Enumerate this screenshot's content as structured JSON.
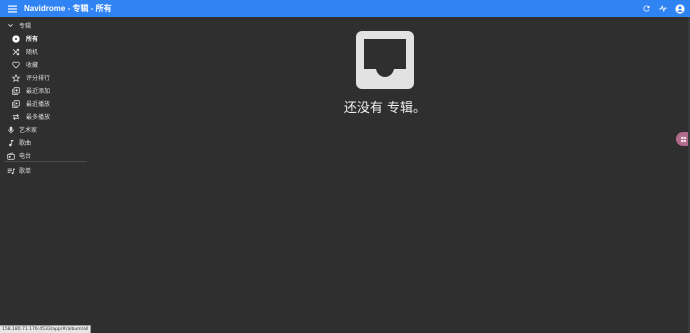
{
  "appbar": {
    "title": "Navidrome - 专辑 - 所有",
    "color": "#2f83f2"
  },
  "sidebar": {
    "items": [
      {
        "label": "专辑",
        "icon": "chevron-down-icon",
        "level": "top"
      },
      {
        "label": "所有",
        "icon": "album-disc-icon",
        "level": "sub",
        "active": true
      },
      {
        "label": "随机",
        "icon": "shuffle-icon",
        "level": "sub"
      },
      {
        "label": "收藏",
        "icon": "heart-icon",
        "level": "sub"
      },
      {
        "label": "评分排行",
        "icon": "star-icon",
        "level": "sub"
      },
      {
        "label": "最近添加",
        "icon": "library-add-icon",
        "level": "sub"
      },
      {
        "label": "最近播放",
        "icon": "library-play-icon",
        "level": "sub"
      },
      {
        "label": "最多播放",
        "icon": "repeat-icon",
        "level": "sub"
      },
      {
        "label": "艺术家",
        "icon": "microphone-icon",
        "level": "top"
      },
      {
        "label": "歌曲",
        "icon": "music-note-icon",
        "level": "top"
      },
      {
        "label": "电台",
        "icon": "radio-icon",
        "level": "top"
      },
      {
        "label": "歌单",
        "icon": "playlist-icon",
        "level": "top"
      }
    ]
  },
  "main": {
    "empty_message": "还没有 专辑。",
    "empty_icon": "inbox-icon"
  },
  "status_url": "158.180.71.176:4533/app/#/album/all",
  "float_button": {
    "icon": "activity-icon"
  }
}
